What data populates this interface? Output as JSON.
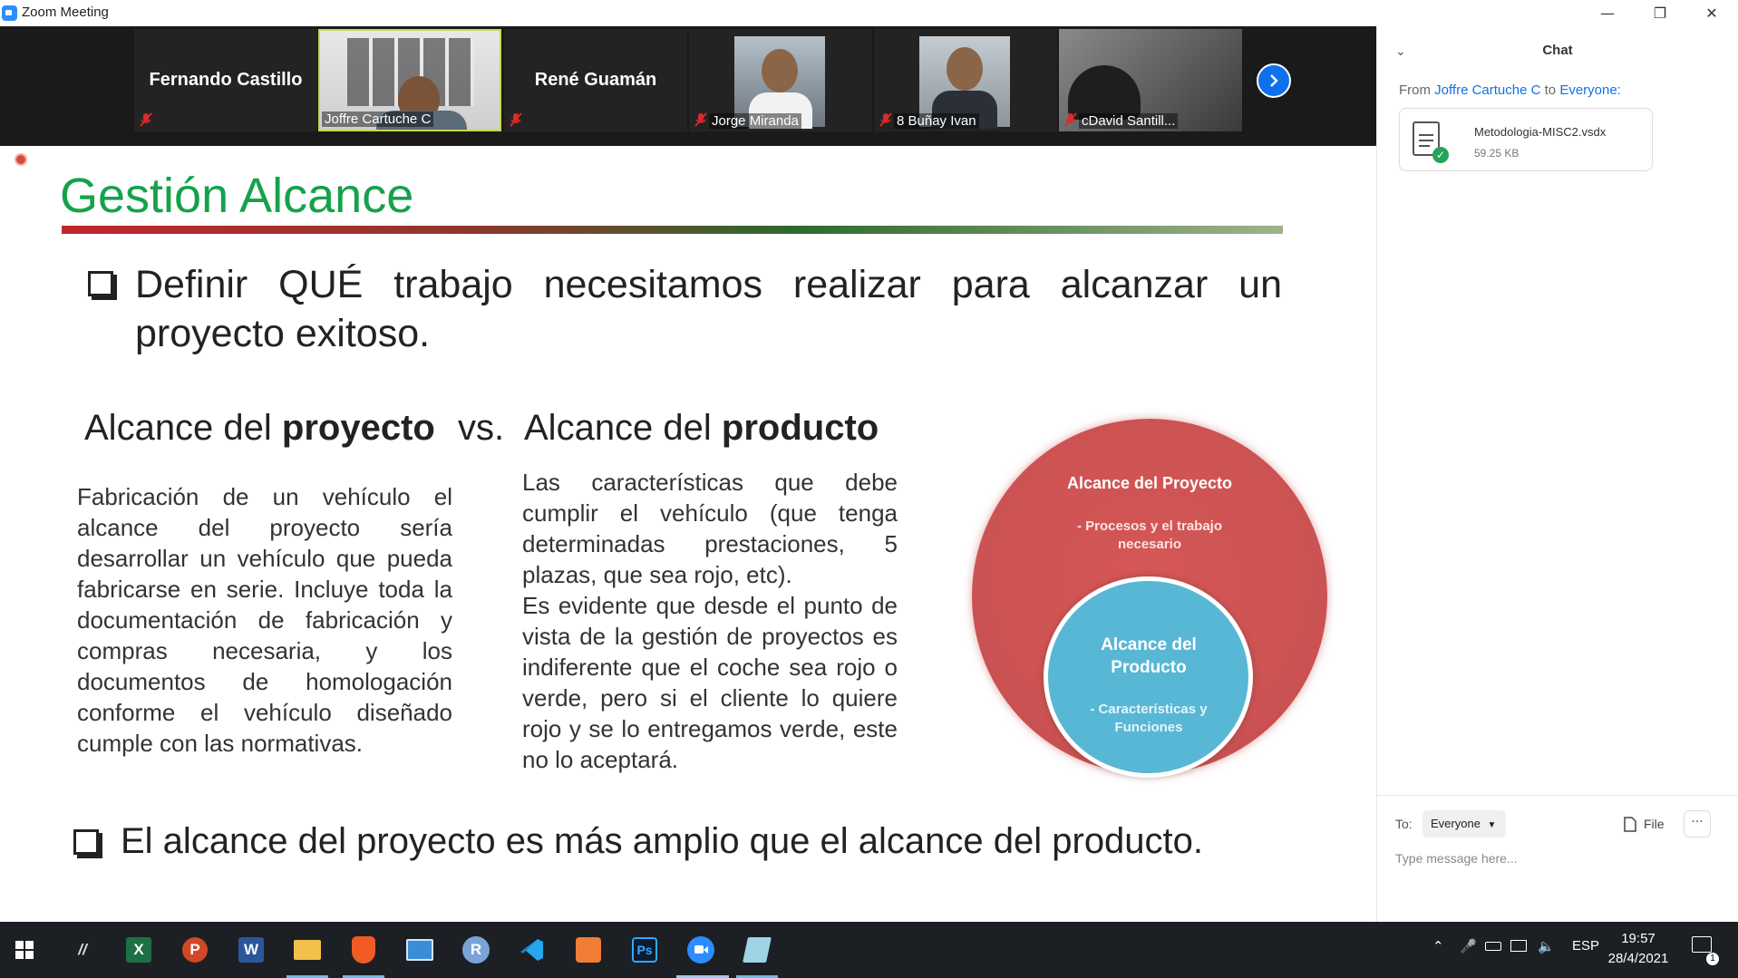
{
  "window": {
    "title": "Zoom Meeting",
    "controls": [
      "minimize",
      "restore",
      "close"
    ]
  },
  "gallery": {
    "participants": [
      {
        "name": "Fernando Castillo",
        "video": false,
        "muted": true
      },
      {
        "name": "Joffre Cartuche C",
        "video": true,
        "muted": false,
        "active_speaker": true
      },
      {
        "name": "René Guamán",
        "video": false,
        "muted": true
      },
      {
        "name": "Jorge Miranda",
        "video": true,
        "muted": true
      },
      {
        "name": "8 Buñay Ivan",
        "video": true,
        "muted": true
      },
      {
        "name": "cDavid Santill...",
        "video": true,
        "muted": true
      }
    ],
    "next_page_icon": "chevron-right-icon"
  },
  "slide": {
    "title": "Gestión Alcance",
    "bullet1": "Definir QUÉ trabajo necesitamos realizar para alcanzar un proyecto exitoso.",
    "heading_left_prefix": "Alcance del",
    "heading_left_bold": "proyecto",
    "heading_vs": "vs.",
    "heading_right_prefix": "Alcance del",
    "heading_right_bold": "producto",
    "paragraph_left": "Fabricación de un vehículo el alcance del proyecto sería desarrollar un vehículo que pueda fabricarse en serie. Incluye toda la documentación de fabricación y compras necesaria, y los documentos de homologación conforme el vehículo diseñado cumple con las normativas.",
    "paragraph_right_1": "Las características que debe cumplir el vehículo (que tenga determinadas prestaciones, 5 plazas, que sea rojo, etc).",
    "paragraph_right_2": "Es evidente que desde el punto de vista de la gestión de proyectos es indiferente que el coche sea rojo o verde, pero si el cliente lo quiere rojo y se lo entregamos verde, este no lo aceptará.",
    "diagram": {
      "outer_title": "Alcance del Proyecto",
      "outer_sub": "- Procesos y el trabajo necesario",
      "inner_title": "Alcance del Producto",
      "inner_sub": "- Características y Funciones",
      "outer_color": "#cc5353",
      "inner_color": "#58b7d4"
    },
    "bullet2": "El alcance del proyecto es más amplio que el alcance del producto.",
    "title_color": "#14a24a"
  },
  "chat": {
    "title": "Chat",
    "from_prefix": "From",
    "from_sender": "Joffre Cartuche C",
    "from_to": "to",
    "from_recipient": "Everyone:",
    "file": {
      "name": "Metodologia-MISC2.vsdx",
      "size": "59.25 KB"
    },
    "to_label": "To:",
    "to_value": "Everyone",
    "file_button": "File",
    "more_button": "···",
    "input_placeholder": "Type message here..."
  },
  "taskbar": {
    "apps": [
      "start-icon",
      "app-icon",
      "excel-icon",
      "powerpoint-icon",
      "word-icon",
      "file-explorer-icon",
      "brave-icon",
      "app-icon",
      "r-icon",
      "vscode-icon",
      "app-icon",
      "photoshop-icon",
      "zoom-icon",
      "app-icon"
    ],
    "language": "ESP",
    "time": "19:57",
    "date": "28/4/2021",
    "notification_count": "1"
  }
}
